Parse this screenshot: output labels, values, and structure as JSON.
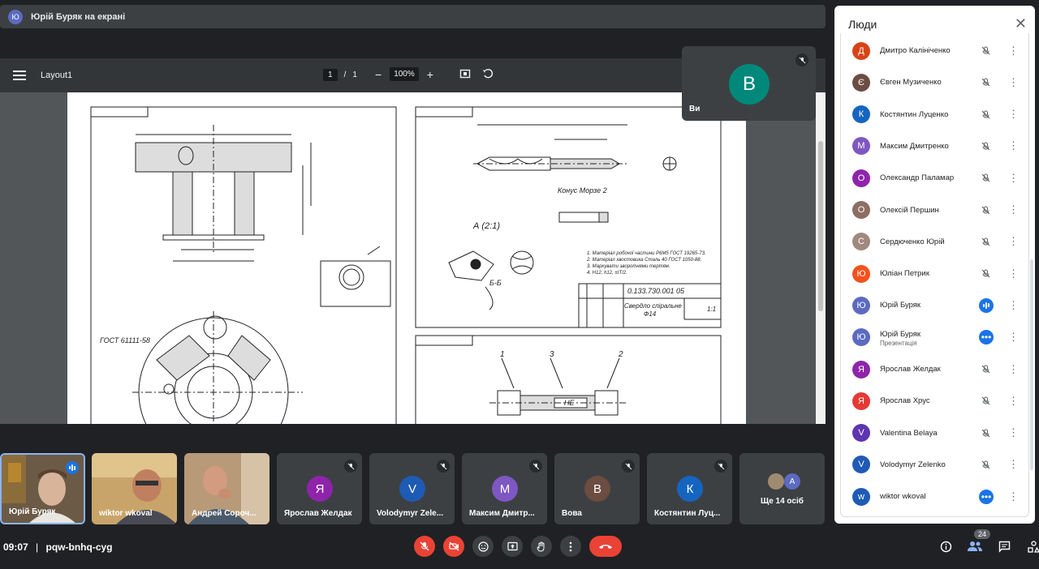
{
  "presenting": {
    "avatar_letter": "Ю",
    "text": "Юрій Буряк на екрані"
  },
  "pdf": {
    "title": "Layout1",
    "page_current": "1",
    "page_sep": "/",
    "page_total": "1",
    "zoom": "100%"
  },
  "drawing": {
    "gost_label": "ГОСТ 61111-58",
    "section_label": "А (2:1)",
    "section_bb": "Б-Б",
    "morse_label": "Конус Морзе 2",
    "code": "0.133.730.001  05",
    "part_name": "Свердло спіральне",
    "part_size": "Ф14",
    "scale": "1:1",
    "callouts": [
      "1",
      "3",
      "2"
    ],
    "ne_label": "НЕ",
    "notes": [
      "1. Матеріал робочої частини Р6М5 ГОСТ 19265-73.",
      "2. Матеріал хвостовика Сталь 40 ГОСТ 1050-88.",
      "3. Маркувати зворотнями тертям.",
      "4. Н12, h12, ±IT/2."
    ]
  },
  "self_tile": {
    "letter": "В",
    "name": "Ви",
    "color": "#00897b"
  },
  "tiles": [
    {
      "name": "Юрій Буряк",
      "type": "video",
      "active": true
    },
    {
      "name": "wiktor wkoval",
      "type": "video"
    },
    {
      "name": "Андрей Сороч...",
      "type": "video"
    },
    {
      "name": "Ярослав Желдак",
      "letter": "Я",
      "color": "#8e24aa"
    },
    {
      "name": "Volodymyr Zele...",
      "letter": "V",
      "color": "#1e5bb5"
    },
    {
      "name": "Максим Дмитр...",
      "letter": "М",
      "color": "#7e57c2"
    },
    {
      "name": "Вова",
      "letter": "В",
      "color": "#6d4c41"
    },
    {
      "name": "Костянтин Луц...",
      "letter": "К",
      "color": "#1565c0"
    },
    {
      "name": "Ще 14 осіб",
      "letter": "А",
      "color": "#5c6bc0"
    }
  ],
  "bottom": {
    "time": "09:07",
    "sep": "|",
    "meeting_code": "pqw-bnhq-cyg",
    "people_count": "24"
  },
  "panel": {
    "title": "Люди",
    "people": [
      {
        "name": "Дмитро Калініченко",
        "letter": "Д",
        "color": "#d84315",
        "mic": "off"
      },
      {
        "name": "Євген Музиченко",
        "letter": "Є",
        "color": "#6d4c41",
        "mic": "off"
      },
      {
        "name": "Костянтин Луценко",
        "letter": "К",
        "color": "#1565c0",
        "mic": "off"
      },
      {
        "name": "Максим Дмитренко",
        "letter": "М",
        "color": "#7e57c2",
        "mic": "off"
      },
      {
        "name": "Олександр Паламар",
        "letter": "О",
        "color": "#8e24aa",
        "mic": "off"
      },
      {
        "name": "Олексій Першин",
        "letter": "О",
        "color": "#8d6e63",
        "mic": "off"
      },
      {
        "name": "Сердюченко Юрій",
        "letter": "С",
        "color": "#a1887f",
        "mic": "off"
      },
      {
        "name": "Юліан Петрик",
        "letter": "Ю",
        "color": "#f4511e",
        "mic": "off"
      },
      {
        "name": "Юрій Буряк",
        "letter": "Ю",
        "color": "#5c6bc0",
        "mic": "speaking"
      },
      {
        "name": "Юрій Буряк",
        "sub": "Презентація",
        "letter": "Ю",
        "color": "#5c6bc0",
        "mic": "more"
      },
      {
        "name": "Ярослав Желдак",
        "letter": "Я",
        "color": "#8e24aa",
        "mic": "off"
      },
      {
        "name": "Ярослав Хрус",
        "letter": "Я",
        "color": "#e53935",
        "mic": "off"
      },
      {
        "name": "Valentina Belaya",
        "letter": "V",
        "color": "#5e35b1",
        "mic": "off"
      },
      {
        "name": "Volodymyr Zelenko",
        "letter": "V",
        "color": "#1e5bb5",
        "mic": "off"
      },
      {
        "name": "wiktor wkoval",
        "letter": "w",
        "color": "#1e5bb5",
        "mic": "more"
      }
    ]
  }
}
